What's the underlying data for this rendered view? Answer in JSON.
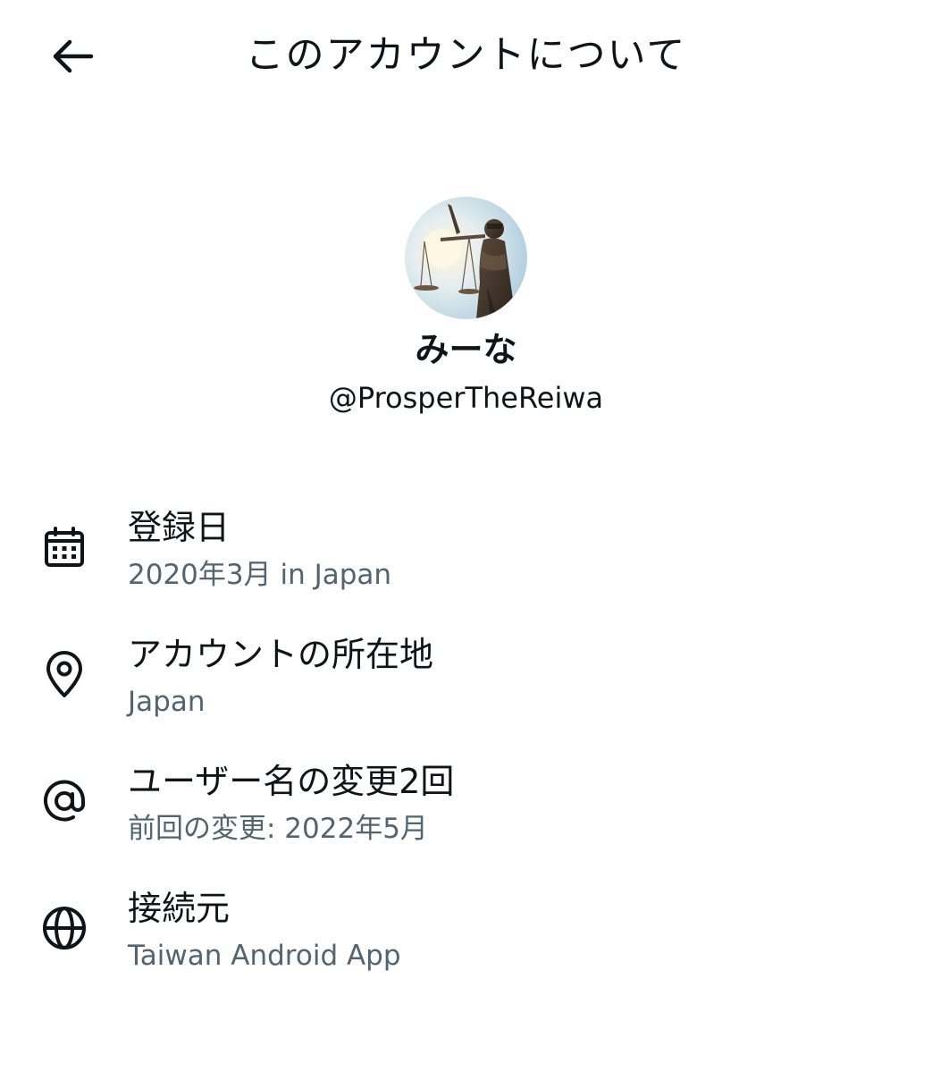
{
  "header": {
    "title": "このアカウントについて",
    "back_icon": "arrow-left-icon"
  },
  "profile": {
    "display_name": "みーな",
    "handle": "@ProsperTheReiwa",
    "avatar": "statue-of-justice-avatar"
  },
  "info": [
    {
      "icon": "calendar-icon",
      "title": "登録日",
      "subtitle": "2020年3月 in Japan"
    },
    {
      "icon": "location-pin-icon",
      "title": "アカウントの所在地",
      "subtitle": "Japan"
    },
    {
      "icon": "at-sign-icon",
      "title": "ユーザー名の変更2回",
      "subtitle": "前回の変更: 2022年5月"
    },
    {
      "icon": "globe-icon",
      "title": "接続元",
      "subtitle": "Taiwan Android App"
    }
  ],
  "colors": {
    "primary_text": "#0f1419",
    "secondary_text": "#536471",
    "background": "#ffffff"
  }
}
